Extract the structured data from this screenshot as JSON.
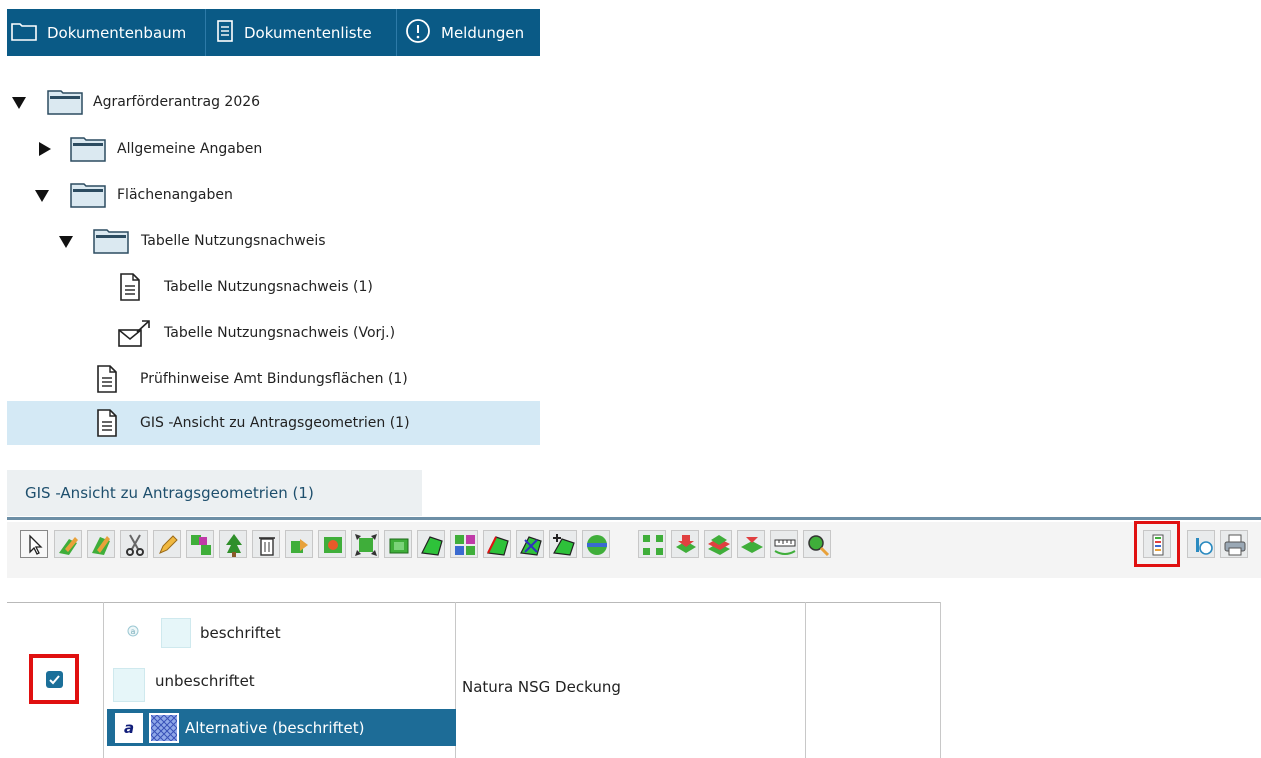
{
  "tabs": [
    {
      "label": "Dokumentenbaum",
      "icon": "folder-icon"
    },
    {
      "label": "Dokumentenliste",
      "icon": "document-list-icon"
    },
    {
      "label": "Meldungen",
      "icon": "alert-circle-icon"
    }
  ],
  "tree": {
    "root": "Agrarförderantrag 2026",
    "general": "Allgemeine Angaben",
    "areas": "Flächenangaben",
    "usage_table": "Tabelle Nutzungsnachweis",
    "usage_table_1": "Tabelle Nutzungsnachweis (1)",
    "usage_table_prev": "Tabelle Nutzungsnachweis (Vorj.)",
    "check_hints": "Prüfhinweise Amt Bindungsflächen (1)",
    "gis_view": "GIS -Ansicht zu Antragsgeometrien (1)",
    "selected_item": "GIS -Ansicht zu Antragsgeometrien (1)"
  },
  "panel": {
    "title": "GIS -Ansicht zu Antragsgeometrien (1)",
    "highlighted_tool": "layer-list-icon"
  },
  "toolbar_tools": [
    "select-pointer-icon",
    "edit-geometry-icon",
    "edit-geometry-alt-icon",
    "cut-icon",
    "pencil-icon",
    "merge-icon",
    "tree-icon",
    "delete-icon",
    "move-icon",
    "split-icon",
    "expand-nodes-icon",
    "buffer-icon",
    "polygon-icon",
    "multi-select-icon",
    "polygon-red-icon",
    "polygon-cross-icon",
    "polygon-add-icon",
    "globe-icon",
    "zoom-extent-icon",
    "layer-down-icon",
    "layers-icon",
    "layer-flat-icon",
    "measure-icon",
    "search-map-icon",
    "layer-list-icon",
    "info-icon",
    "print-icon"
  ],
  "layer_table": {
    "checkbox_checked": true,
    "labeled": "beschriftet",
    "unlabeled": "unbeschriftet",
    "alternative": "Alternative (beschriftet)",
    "alt_letter": "a",
    "layer_name": "Natura NSG Deckung"
  },
  "colors": {
    "tab_bar": "#0a5a86",
    "selected_row": "#d4e9f5",
    "highlight": "#e01010",
    "alt_row": "#1d6c97"
  }
}
